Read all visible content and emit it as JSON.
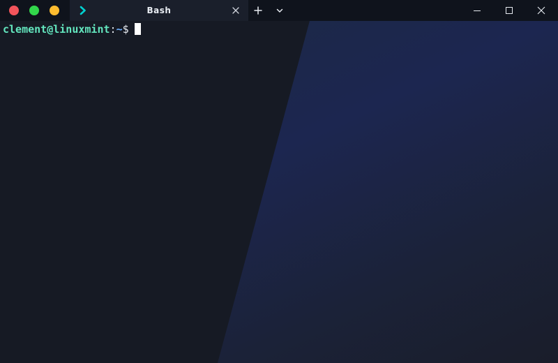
{
  "window": {
    "tab_title": "Bash",
    "accent_color": "#00d1d1"
  },
  "traffic_lights": [
    {
      "name": "close",
      "color": "#f2545b"
    },
    {
      "name": "maximize",
      "color": "#32d74b"
    },
    {
      "name": "minimize",
      "color": "#fdbc2f"
    }
  ],
  "icons": {
    "tab": "chevron-right-icon",
    "tab_close": "close-icon",
    "new_tab": "plus-icon",
    "dropdown": "chevron-down-icon",
    "minimize": "minimize-icon",
    "maximize": "maximize-icon",
    "close_window": "close-icon"
  },
  "terminal": {
    "prompt_user": "clement@linuxmint",
    "prompt_sep": ":",
    "prompt_path": "~",
    "prompt_symbol": "$",
    "user_color": "#63e6be",
    "path_color": "#6bb0ff"
  }
}
